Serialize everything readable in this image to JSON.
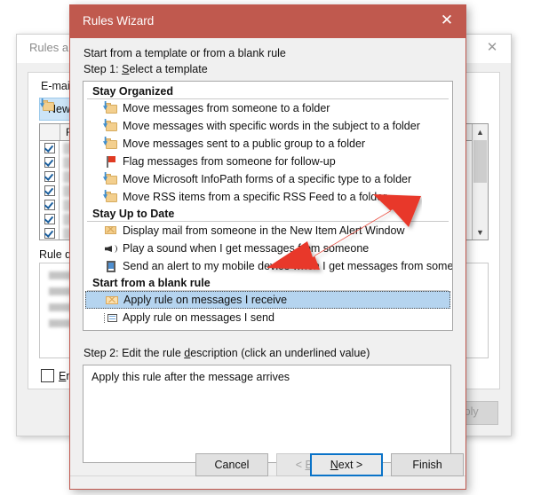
{
  "background_window": {
    "title": "Rules and A",
    "close_icon": "close-icon",
    "tabs_label": "E-mail Rule",
    "new_rule_button": "New R",
    "table": {
      "header_rule": "Rule (",
      "rows": [
        {
          "checked": true,
          "name_redacted": true,
          "action_text": "..."
        },
        {
          "checked": true,
          "name_redacted": true,
          "action_text": "..."
        },
        {
          "checked": true,
          "name_redacted": true,
          "action_text": "..."
        },
        {
          "checked": true,
          "name_redacted": true,
          "action_text": "..."
        },
        {
          "checked": true,
          "name_redacted": true,
          "action_text": "..."
        },
        {
          "checked": true,
          "name_redacted": true,
          "action_text": "..."
        },
        {
          "checked": true,
          "name_redacted": true,
          "action_text": "..."
        }
      ]
    },
    "rule_description_label": "Rule descr",
    "enable_checkbox_label": "Enable",
    "apply_button": "Apply"
  },
  "wizard": {
    "title": "Rules Wizard",
    "close_icon": "close-icon",
    "heading": "Start from a template or from a blank rule",
    "step1_label": "Step 1: Select a template",
    "step1_accel": "S",
    "groups": [
      {
        "name": "Stay Organized",
        "items": [
          {
            "icon": "folder-move-icon",
            "label": "Move messages from someone to a folder",
            "selected": false
          },
          {
            "icon": "folder-move-icon",
            "label": "Move messages with specific words in the subject to a folder",
            "selected": false
          },
          {
            "icon": "folder-move-icon",
            "label": "Move messages sent to a public group to a folder",
            "selected": false
          },
          {
            "icon": "flag-icon",
            "label": "Flag messages from someone for follow-up",
            "selected": false
          },
          {
            "icon": "folder-move-icon",
            "label": "Move Microsoft InfoPath forms of a specific type to a folder",
            "selected": false
          },
          {
            "icon": "folder-move-icon",
            "label": "Move RSS items from a specific RSS Feed to a folder",
            "selected": false
          }
        ]
      },
      {
        "name": "Stay Up to Date",
        "items": [
          {
            "icon": "envelope-star-icon",
            "label": "Display mail from someone in the New Item Alert Window",
            "selected": false
          },
          {
            "icon": "speaker-icon",
            "label": "Play a sound when I get messages from someone",
            "selected": false
          },
          {
            "icon": "mobile-device-icon",
            "label": "Send an alert to my mobile device when I get messages from someone",
            "selected": false
          }
        ]
      },
      {
        "name": "Start from a blank rule",
        "items": [
          {
            "icon": "envelope-icon",
            "label": "Apply rule on messages I receive",
            "selected": true
          },
          {
            "icon": "send-message-icon",
            "label": "Apply rule on messages I send",
            "selected": false
          }
        ]
      }
    ],
    "step2_label": "Step 2: Edit the rule description (click an underlined value)",
    "step2_accel": "d",
    "description_text": "Apply this rule after the message arrives",
    "buttons": {
      "cancel": "Cancel",
      "back": "< Back",
      "back_accel": "B",
      "next": "Next >",
      "next_accel": "N",
      "finish": "Finish"
    }
  },
  "annotation": {
    "arrow_color": "#e8392a",
    "name": "red-pointer-arrow"
  },
  "colors": {
    "wizard_titlebar": "#c0594e",
    "selection": "#b5d4ef",
    "default_button_border": "#0a73c8"
  }
}
